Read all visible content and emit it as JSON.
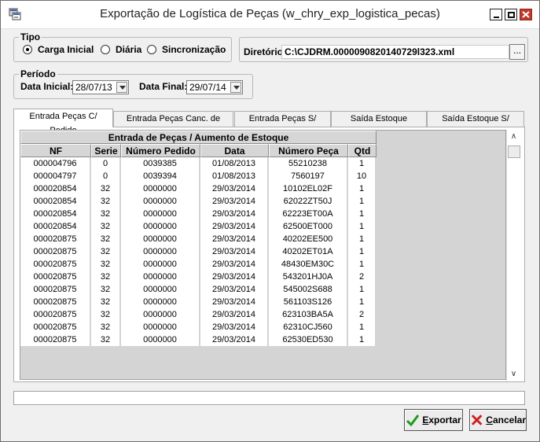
{
  "window": {
    "title": "Exportação de Logística de Peças (w_chry_exp_logistica_pecas)"
  },
  "tipo": {
    "label": "Tipo",
    "options": [
      {
        "label": "Carga Inicial",
        "selected": true
      },
      {
        "label": "Diária",
        "selected": false
      },
      {
        "label": "Sincronização",
        "selected": false
      }
    ]
  },
  "diretorio": {
    "label": "Diretório:",
    "value": "C:\\CJDRM.0000090820140729l323.xml",
    "browse_label": "..."
  },
  "periodo": {
    "label": "Período",
    "data_inicial_label": "Data Inicial:",
    "data_inicial_value": "28/07/13",
    "data_final_label": "Data Final:",
    "data_final_value": "29/07/14"
  },
  "tabs": [
    {
      "label": "Entrada Peças C/ Pedido",
      "active": true
    },
    {
      "label": "Entrada Peças Canc. de Vendas",
      "active": false
    },
    {
      "label": "Entrada Peças S/ Pedido",
      "active": false
    },
    {
      "label": "Saída Estoque C/Pedido",
      "active": false
    },
    {
      "label": "Saída Estoque S/ Pedido",
      "active": false
    }
  ],
  "grid": {
    "group_header": "Entrada de Peças / Aumento de Estoque",
    "columns": [
      "NF",
      "Serie",
      "Número Pedido",
      "Data",
      "Número Peça",
      "Qtd"
    ],
    "rows": [
      [
        "000004796",
        "0",
        "0039385",
        "01/08/2013",
        "55210238",
        "1"
      ],
      [
        "000004797",
        "0",
        "0039394",
        "01/08/2013",
        "7560197",
        "10"
      ],
      [
        "000020854",
        "32",
        "0000000",
        "29/03/2014",
        "10102EL02F",
        "1"
      ],
      [
        "000020854",
        "32",
        "0000000",
        "29/03/2014",
        "62022ZT50J",
        "1"
      ],
      [
        "000020854",
        "32",
        "0000000",
        "29/03/2014",
        "62223ET00A",
        "1"
      ],
      [
        "000020854",
        "32",
        "0000000",
        "29/03/2014",
        "62500ET000",
        "1"
      ],
      [
        "000020875",
        "32",
        "0000000",
        "29/03/2014",
        "40202EE500",
        "1"
      ],
      [
        "000020875",
        "32",
        "0000000",
        "29/03/2014",
        "40202ET01A",
        "1"
      ],
      [
        "000020875",
        "32",
        "0000000",
        "29/03/2014",
        "48430EM30C",
        "1"
      ],
      [
        "000020875",
        "32",
        "0000000",
        "29/03/2014",
        "543201HJ0A",
        "2"
      ],
      [
        "000020875",
        "32",
        "0000000",
        "29/03/2014",
        "545002S688",
        "1"
      ],
      [
        "000020875",
        "32",
        "0000000",
        "29/03/2014",
        "561103S126",
        "1"
      ],
      [
        "000020875",
        "32",
        "0000000",
        "29/03/2014",
        "623103BA5A",
        "2"
      ],
      [
        "000020875",
        "32",
        "0000000",
        "29/03/2014",
        "62310CJ560",
        "1"
      ],
      [
        "000020875",
        "32",
        "0000000",
        "29/03/2014",
        "62530ED530",
        "1"
      ]
    ]
  },
  "status": {
    "text": ""
  },
  "buttons": {
    "exportar_label": "Exportar",
    "cancelar_label": "Cancelar"
  },
  "icons": {
    "app": "app-window-icon",
    "exportar": "green-check-icon",
    "cancelar": "red-x-icon"
  }
}
